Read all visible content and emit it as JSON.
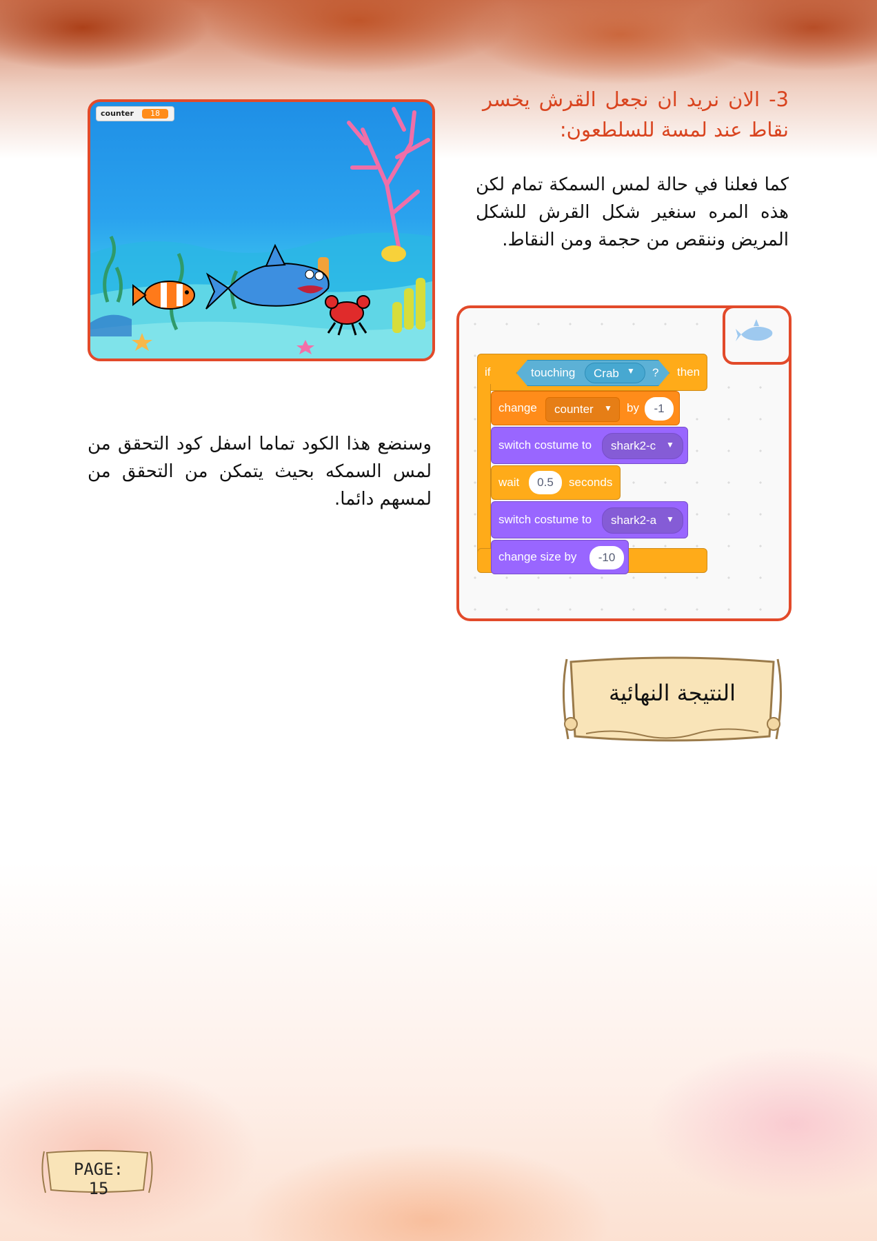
{
  "instructions": {
    "heading": "3- الان نريد ان نجعل القرش يخسر نقاط عند لمسة للسلطعون:",
    "paragraph_1": "كما فعلنا في حالة لمس السمكة تمام لكن هذه المره سنغير شكل القرش للشكل المريض وننقص من حجمة ومن النقاط.",
    "paragraph_2": "وسنضع هذا الكود تماما اسفل كود التحقق من لمس السمكه بحيث يتمكن من التحقق من لمسهم دائما."
  },
  "stage": {
    "monitor": {
      "label": "counter",
      "value": "18"
    },
    "sprites": [
      "clownfish",
      "shark",
      "crab",
      "coral",
      "seaweed",
      "starfish"
    ]
  },
  "code": {
    "sprite_thumbnail": "shark-icon",
    "if_block": {
      "if": "if",
      "touching": "touching",
      "target": "Crab",
      "question": "?",
      "then": "then"
    },
    "change_block": {
      "label": "change",
      "variable": "counter",
      "by": "by",
      "value": "-1"
    },
    "switch_1": {
      "label": "switch costume to",
      "costume": "shark2-c"
    },
    "wait_block": {
      "label": "wait",
      "value": "0.5",
      "unit": "seconds"
    },
    "switch_2": {
      "label": "switch costume to",
      "costume": "shark2-a"
    },
    "size_block": {
      "label": "change size by",
      "value": "-10"
    },
    "colors": {
      "control": "#ffab19",
      "variables": "#ff8c1a",
      "looks": "#9966ff",
      "sensing": "#5cb1d6"
    }
  },
  "result": {
    "title": "النتيجة النهائية"
  },
  "footer": {
    "page_label": "PAGE: 15"
  },
  "colors": {
    "accent": "#e24a2a",
    "heading": "#d9441f"
  }
}
